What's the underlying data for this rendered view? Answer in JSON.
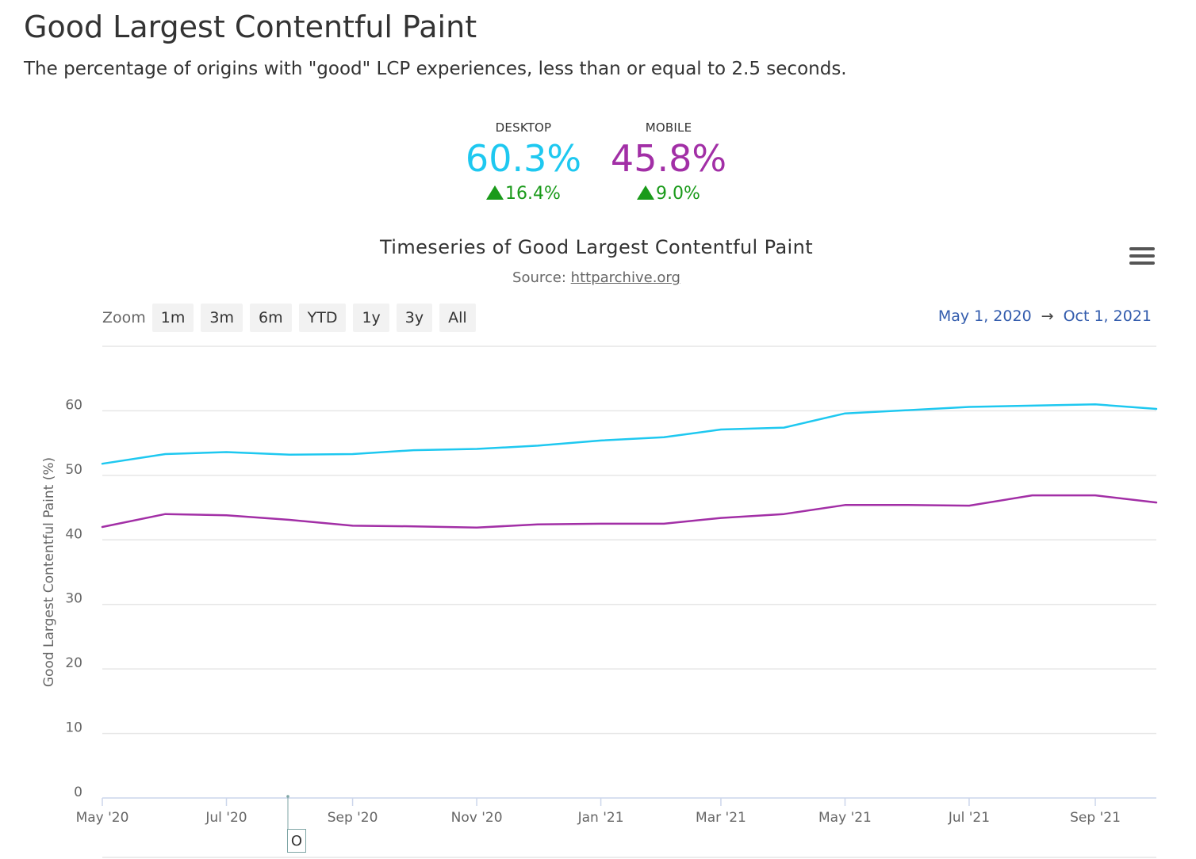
{
  "header": {
    "title": "Good Largest Contentful Paint",
    "description": "The percentage of origins with \"good\" LCP experiences, less than or equal to 2.5 seconds."
  },
  "stats": {
    "desktop": {
      "label": "DESKTOP",
      "value": "60.3%",
      "change": "16.4%",
      "color": "#1ec8f0"
    },
    "mobile": {
      "label": "MOBILE",
      "value": "45.8%",
      "change": "9.0%",
      "color": "#a22fa6"
    },
    "change_color": "#1a9a1a"
  },
  "chart": {
    "title": "Timeseries of Good Largest Contentful Paint",
    "source_prefix": "Source:",
    "source_link": "httparchive.org",
    "menu_icon": "hamburger-menu-icon",
    "zoom": {
      "label": "Zoom",
      "buttons": [
        "1m",
        "3m",
        "6m",
        "YTD",
        "1y",
        "3y",
        "All"
      ]
    },
    "range": {
      "from": "May 1, 2020",
      "arrow": "→",
      "to": "Oct 1, 2021"
    },
    "navigator_label": "O"
  },
  "chart_data": {
    "type": "line",
    "title": "Timeseries of Good Largest Contentful Paint",
    "subtitle": "Source: httparchive.org",
    "ylabel": "Good Largest Contentful Paint (%)",
    "xlabel": "",
    "ylim": [
      0,
      70
    ],
    "yticks": [
      0,
      10,
      20,
      30,
      40,
      50,
      60
    ],
    "x_tick_labels": [
      "May '20",
      "Jul '20",
      "Sep '20",
      "Nov '20",
      "Jan '21",
      "Mar '21",
      "May '21",
      "Jul '21",
      "Sep '21"
    ],
    "x": [
      "2020-05-01",
      "2020-06-01",
      "2020-07-01",
      "2020-08-01",
      "2020-09-01",
      "2020-10-01",
      "2020-11-01",
      "2020-12-01",
      "2021-01-01",
      "2021-02-01",
      "2021-03-01",
      "2021-04-01",
      "2021-05-01",
      "2021-06-01",
      "2021-07-01",
      "2021-08-01",
      "2021-09-01",
      "2021-10-01"
    ],
    "series": [
      {
        "name": "Desktop",
        "color": "#1ec8f0",
        "values": [
          51.8,
          53.3,
          53.6,
          53.2,
          53.3,
          53.9,
          54.1,
          54.6,
          55.4,
          55.9,
          57.1,
          57.4,
          59.6,
          60.1,
          60.6,
          60.8,
          61.0,
          60.3
        ]
      },
      {
        "name": "Mobile",
        "color": "#a22fa6",
        "values": [
          42.0,
          44.0,
          43.8,
          43.1,
          42.2,
          42.1,
          41.9,
          42.4,
          42.5,
          42.5,
          43.4,
          44.0,
          45.4,
          45.4,
          45.3,
          46.9,
          46.9,
          45.8
        ]
      }
    ],
    "grid": true,
    "legend": "none"
  }
}
